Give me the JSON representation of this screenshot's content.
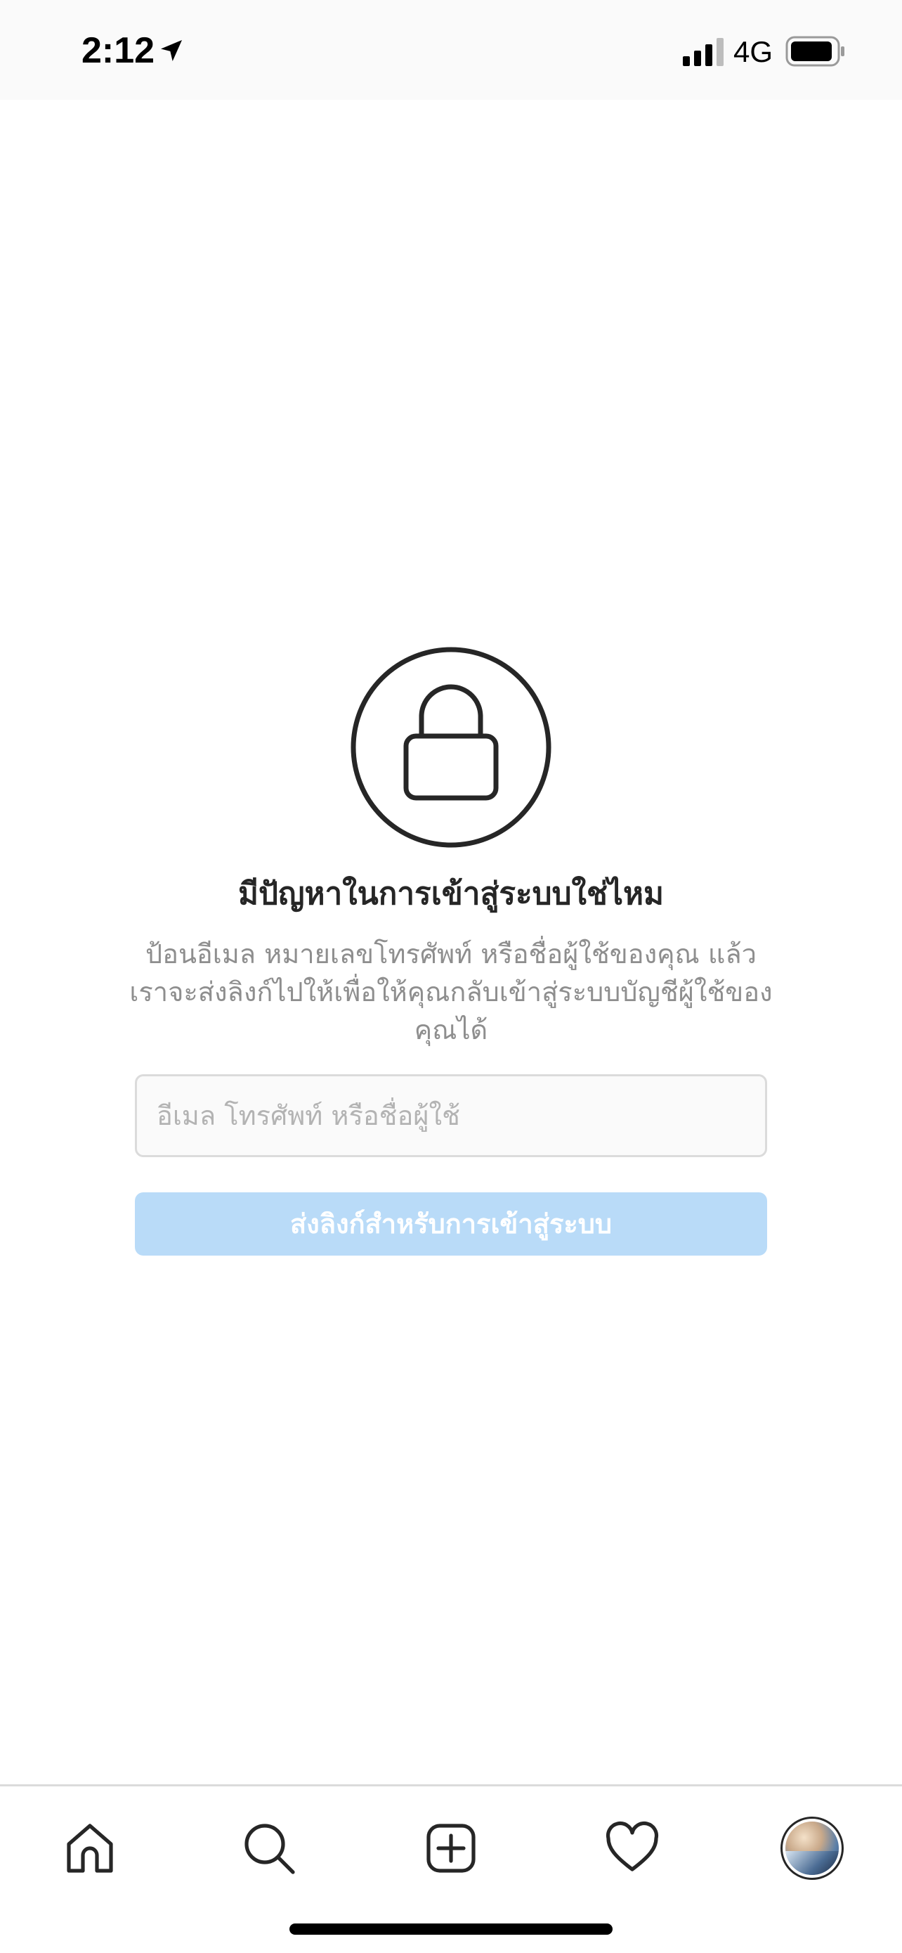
{
  "status_bar": {
    "time": "2:12",
    "network": "4G"
  },
  "main": {
    "headline": "มีปัญหาในการเข้าสู่ระบบใช่ไหม",
    "description": "ป้อนอีเมล หมายเลขโทรศัพท์ หรือชื่อผู้ใช้ของคุณ แล้วเราจะส่งลิงก์ไปให้เพื่อให้คุณกลับเข้าสู่ระบบบัญชีผู้ใช้ของคุณได้",
    "input_placeholder": "อีเมล โทรศัพท์ หรือชื่อผู้ใช้",
    "input_value": "",
    "submit_label": "ส่งลิงก์สำหรับการเข้าสู่ระบบ"
  },
  "bottom_nav": {
    "items": [
      {
        "icon": "home-icon"
      },
      {
        "icon": "search-icon"
      },
      {
        "icon": "add-post-icon"
      },
      {
        "icon": "heart-icon"
      },
      {
        "icon": "avatar"
      }
    ]
  },
  "colors": {
    "button_disabled": "#b9dbf8",
    "border": "#dbdbdb",
    "text_secondary": "#8e8e8e",
    "text_primary": "#262626"
  }
}
